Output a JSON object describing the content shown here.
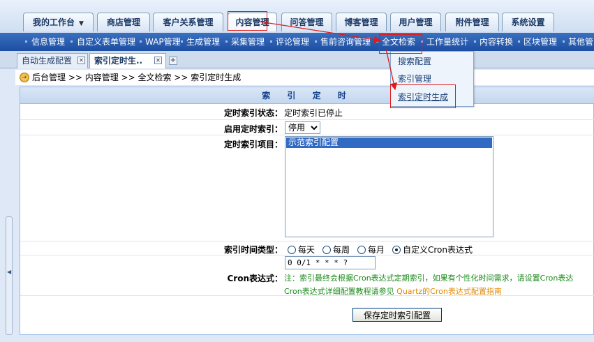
{
  "main_tabs": [
    {
      "label": "我的工作台",
      "has_dropdown": true
    },
    {
      "label": "商店管理"
    },
    {
      "label": "客户关系管理"
    },
    {
      "label": "内容管理",
      "active": true
    },
    {
      "label": "问答管理"
    },
    {
      "label": "博客管理"
    },
    {
      "label": "用户管理"
    },
    {
      "label": "附件管理"
    },
    {
      "label": "系统设置"
    }
  ],
  "sub_nav": [
    "信息管理",
    "自定义表单管理",
    "WAP管理",
    "生成管理",
    "采集管理",
    "评论管理",
    "售前咨询管理",
    "全文检索",
    "工作量统计",
    "内容转换",
    "区块管理",
    "其他管"
  ],
  "dropdown": [
    "搜索配置",
    "索引管理",
    "索引定时生成"
  ],
  "doc_tabs": [
    {
      "label": "自动生成配置",
      "active": false
    },
    {
      "label": "索引定时生..",
      "active": true
    }
  ],
  "breadcrumb": "后台管理 >> 内容管理 >> 全文检索 >> 索引定时生成",
  "panel_title": "索 引 定 时",
  "form": {
    "status_label": "定时索引状态：",
    "status_value": "定时索引已停止",
    "enable_label": "启用定时索引：",
    "enable_value": "停用",
    "items_label": "定时索引项目：",
    "items": [
      "示范索引配置"
    ],
    "time_type_label": "索引时间类型：",
    "time_types": [
      "每天",
      "每周",
      "每月",
      "自定义Cron表达式"
    ],
    "time_type_selected": "自定义Cron表达式",
    "cron_label": "Cron表达式：",
    "cron_value": "0 0/1 * * * ?",
    "note_line1": "注：索引最终会根据Cron表达式定期索引，如果有个性化时间需求，请设置Cron表达",
    "note_line2_prefix": "Cron表达式详细配置教程请参见 ",
    "note_link": "Quartz的Cron表达式配置指南",
    "save_button": "保存定时索引配置"
  },
  "colors": {
    "annotation": "#e01b1b",
    "sub_nav_bg": "#1c4ea2",
    "note_text": "#1a8a1a",
    "note_link": "#e08a00"
  }
}
